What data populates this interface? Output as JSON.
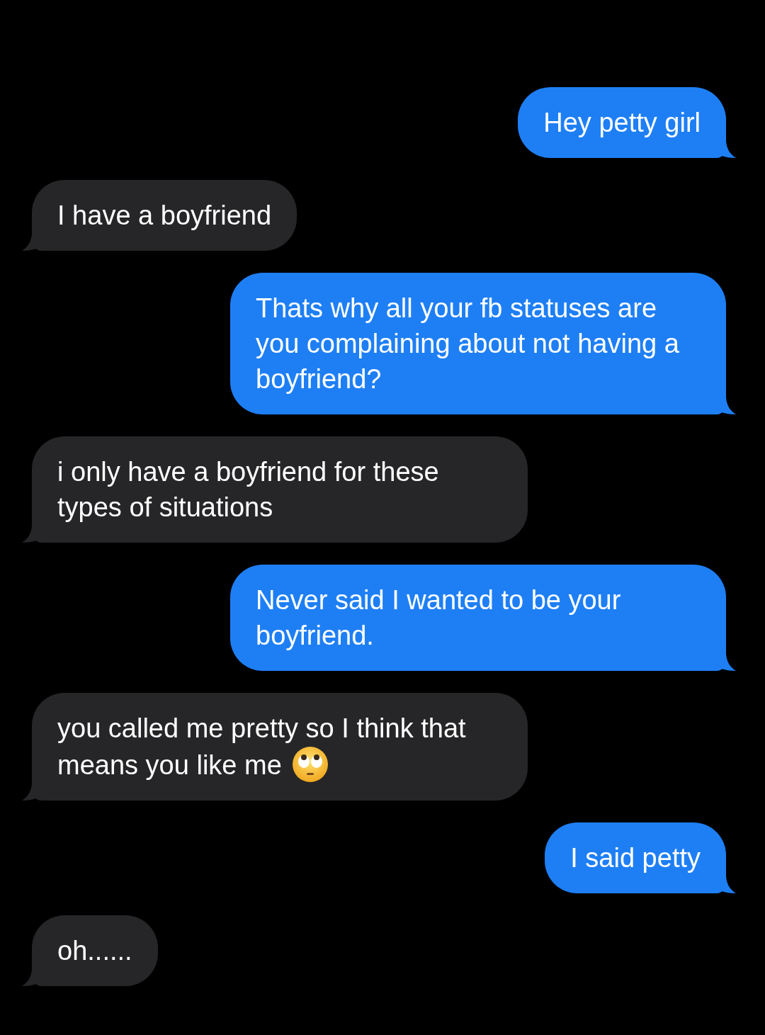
{
  "messages": [
    {
      "kind": "sent",
      "text": "Hey petty girl"
    },
    {
      "kind": "received",
      "text": "I have a boyfriend"
    },
    {
      "kind": "sent",
      "text": "Thats why all your fb statuses are you complaining about not having a boyfriend?"
    },
    {
      "kind": "received",
      "text": "i only have a boyfriend for these types of situations"
    },
    {
      "kind": "sent",
      "text": "Never said I wanted to be your boyfriend."
    },
    {
      "kind": "received",
      "text": "you called me pretty so I think that means you like me",
      "trailing_icon": true
    },
    {
      "kind": "sent",
      "text": "I said petty"
    },
    {
      "kind": "received",
      "text": "oh......"
    }
  ]
}
